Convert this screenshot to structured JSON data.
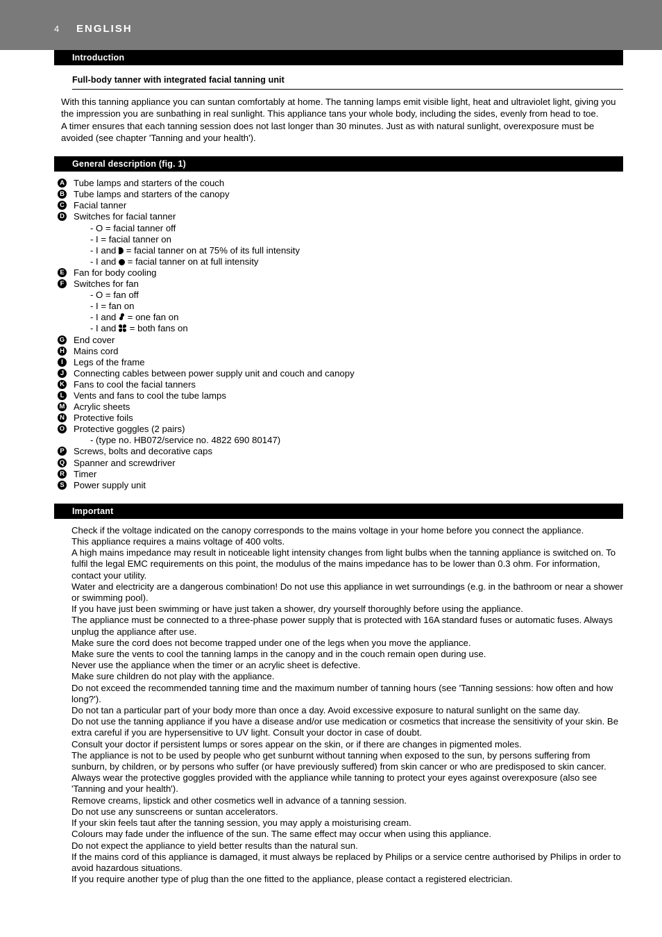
{
  "header": {
    "page_number": "4",
    "language": "ENGLISH"
  },
  "sections": {
    "introduction": {
      "bar_label": "Introduction",
      "subhead": "Full-body tanner with integrated facial tanning unit",
      "paragraph_1": "With this tanning appliance you can suntan comfortably at home. The tanning lamps emit visible light, heat and ultraviolet light, giving you the impression you are sunbathing in real sunlight. This appliance tans your whole body, including the sides, evenly from head to toe.",
      "paragraph_2": "A timer ensures that each tanning session does not last longer than 30 minutes. Just as with natural sunlight, overexposure must be avoided (see chapter 'Tanning and your health')."
    },
    "general_description": {
      "bar_label": "General description (fig. 1)",
      "items": [
        {
          "letter": "A",
          "text": "Tube lamps and starters of the couch",
          "subs": []
        },
        {
          "letter": "B",
          "text": "Tube lamps and starters of the canopy",
          "subs": []
        },
        {
          "letter": "C",
          "text": "Facial tanner",
          "subs": []
        },
        {
          "letter": "D",
          "text": "Switches for facial tanner",
          "subs": [
            {
              "pre": "- O = facial tanner off",
              "glyph": "",
              "post": ""
            },
            {
              "pre": "- I = facial tanner on",
              "glyph": "",
              "post": ""
            },
            {
              "pre": "- I and ",
              "glyph": "half-moon-icon",
              "post": " = facial tanner on at 75% of its full intensity"
            },
            {
              "pre": "- I and ",
              "glyph": "full-circle-icon",
              "post": " = facial tanner on at full intensity"
            }
          ]
        },
        {
          "letter": "E",
          "text": "Fan for body cooling",
          "subs": []
        },
        {
          "letter": "F",
          "text": "Switches for fan",
          "subs": [
            {
              "pre": "- O = fan off",
              "glyph": "",
              "post": ""
            },
            {
              "pre": "- I = fan on",
              "glyph": "",
              "post": ""
            },
            {
              "pre": "- I and ",
              "glyph": "one-fan-icon",
              "post": " = one fan on"
            },
            {
              "pre": "- I and ",
              "glyph": "two-fans-icon",
              "post": " = both fans on"
            }
          ]
        },
        {
          "letter": "G",
          "text": "End cover",
          "subs": []
        },
        {
          "letter": "H",
          "text": "Mains cord",
          "subs": []
        },
        {
          "letter": "I",
          "text": "Legs of the frame",
          "subs": []
        },
        {
          "letter": "J",
          "text": "Connecting cables between power supply unit and couch and canopy",
          "subs": []
        },
        {
          "letter": "K",
          "text": "Fans to cool the facial tanners",
          "subs": []
        },
        {
          "letter": "L",
          "text": "Vents and fans to cool the tube lamps",
          "subs": []
        },
        {
          "letter": "M",
          "text": "Acrylic sheets",
          "subs": []
        },
        {
          "letter": "N",
          "text": "Protective foils",
          "subs": []
        },
        {
          "letter": "O",
          "text": "Protective goggles (2 pairs)",
          "subs": [
            {
              "pre": "- (type no. HB072/service no. 4822 690 80147)",
              "glyph": "",
              "post": ""
            }
          ]
        },
        {
          "letter": "P",
          "text": "Screws, bolts and decorative caps",
          "subs": []
        },
        {
          "letter": "Q",
          "text": "Spanner and screwdriver",
          "subs": []
        },
        {
          "letter": "R",
          "text": "Timer",
          "subs": []
        },
        {
          "letter": "S",
          "text": "Power supply unit",
          "subs": []
        }
      ]
    },
    "important": {
      "bar_label": "Important",
      "items": [
        "Check if the voltage indicated on the canopy corresponds to the mains voltage in your home before you connect the appliance.",
        "This appliance requires a mains voltage of 400 volts.",
        "A high mains impedance may result in noticeable light intensity changes from light bulbs when the tanning appliance is switched on. To fulfil the legal EMC requirements on this point, the modulus of the mains impedance has to be lower than 0.3 ohm. For information, contact your utility.",
        "Water and electricity are a dangerous combination! Do not use this appliance in wet surroundings (e.g. in the bathroom or near a shower or swimming pool).",
        "If you have just been swimming or have just taken a shower, dry yourself thoroughly before using the appliance.",
        "The appliance must be connected to a three-phase power supply that is protected with 16A standard fuses or automatic fuses. Always unplug the appliance after use.",
        "Make sure the cord does not become trapped under one of the legs when you move the appliance.",
        "Make sure the vents to cool the tanning lamps in the canopy and in the couch remain open during use.",
        "Never use the appliance when the timer or an acrylic sheet is defective.",
        "Make sure children do not play with the appliance.",
        "Do not exceed the recommended tanning time and the maximum number of tanning hours (see 'Tanning sessions: how often and how long?').",
        "Do not tan a particular part of your body more than once a day. Avoid excessive exposure to natural sunlight on the same day.",
        "Do not use the tanning appliance if you have a disease and/or use medication or cosmetics that increase the sensitivity of your skin. Be extra careful if you are hypersensitive to UV light. Consult your doctor in case of doubt.",
        "Consult your doctor if persistent lumps or sores appear on the skin, or if there are changes in pigmented moles.",
        "The appliance is not to be used by people who get sunburnt without tanning when exposed to the sun, by persons suffering from sunburn, by children, or by persons who suffer (or have previously suffered) from skin cancer or who are predisposed to skin cancer.",
        "Always wear the protective goggles provided with the appliance while tanning to protect your eyes against overexposure (also see 'Tanning and your health').",
        "Remove creams, lipstick and other cosmetics well in advance of a tanning session.",
        "Do not use any sunscreens or suntan accelerators.",
        "If your skin feels taut after the tanning session, you may apply a moisturising cream.",
        "Colours may fade under the influence of the sun. The same effect may occur when using this appliance.",
        "Do not expect the appliance to yield better results than the natural sun.",
        "If the mains cord of this appliance is damaged, it must always be replaced by Philips or a service centre authorised by Philips in order to avoid hazardous situations.",
        "If you require another type of plug than the one fitted to the appliance, please contact a registered electrician."
      ]
    }
  },
  "colors": {
    "header_band": "#7a7a7a",
    "section_bar": "#000000",
    "text": "#000000"
  }
}
